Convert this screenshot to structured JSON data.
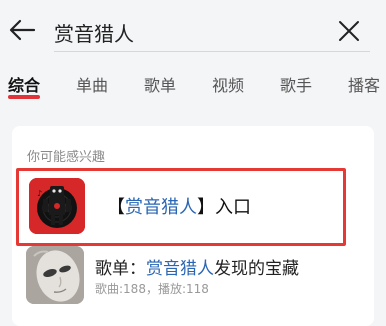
{
  "search": {
    "query": "赏音猎人"
  },
  "tabs": [
    {
      "label": "综合",
      "active": true
    },
    {
      "label": "单曲"
    },
    {
      "label": "歌单"
    },
    {
      "label": "视频"
    },
    {
      "label": "歌手"
    },
    {
      "label": "播客"
    }
  ],
  "suggestion": {
    "section_label": "你可能感兴趣",
    "entry": {
      "bracket_open": "【",
      "highlight": "赏音猎人",
      "bracket_close": "】",
      "suffix": "入口"
    }
  },
  "playlist": {
    "prefix": "歌单：",
    "highlight": "赏音猎人",
    "suffix": "发现的宝藏",
    "meta": "歌曲:188，播放:118"
  },
  "colors": {
    "accent_blue": "#2a66b3",
    "brand_red": "#e1333a",
    "highlight_border": "#e53935"
  }
}
